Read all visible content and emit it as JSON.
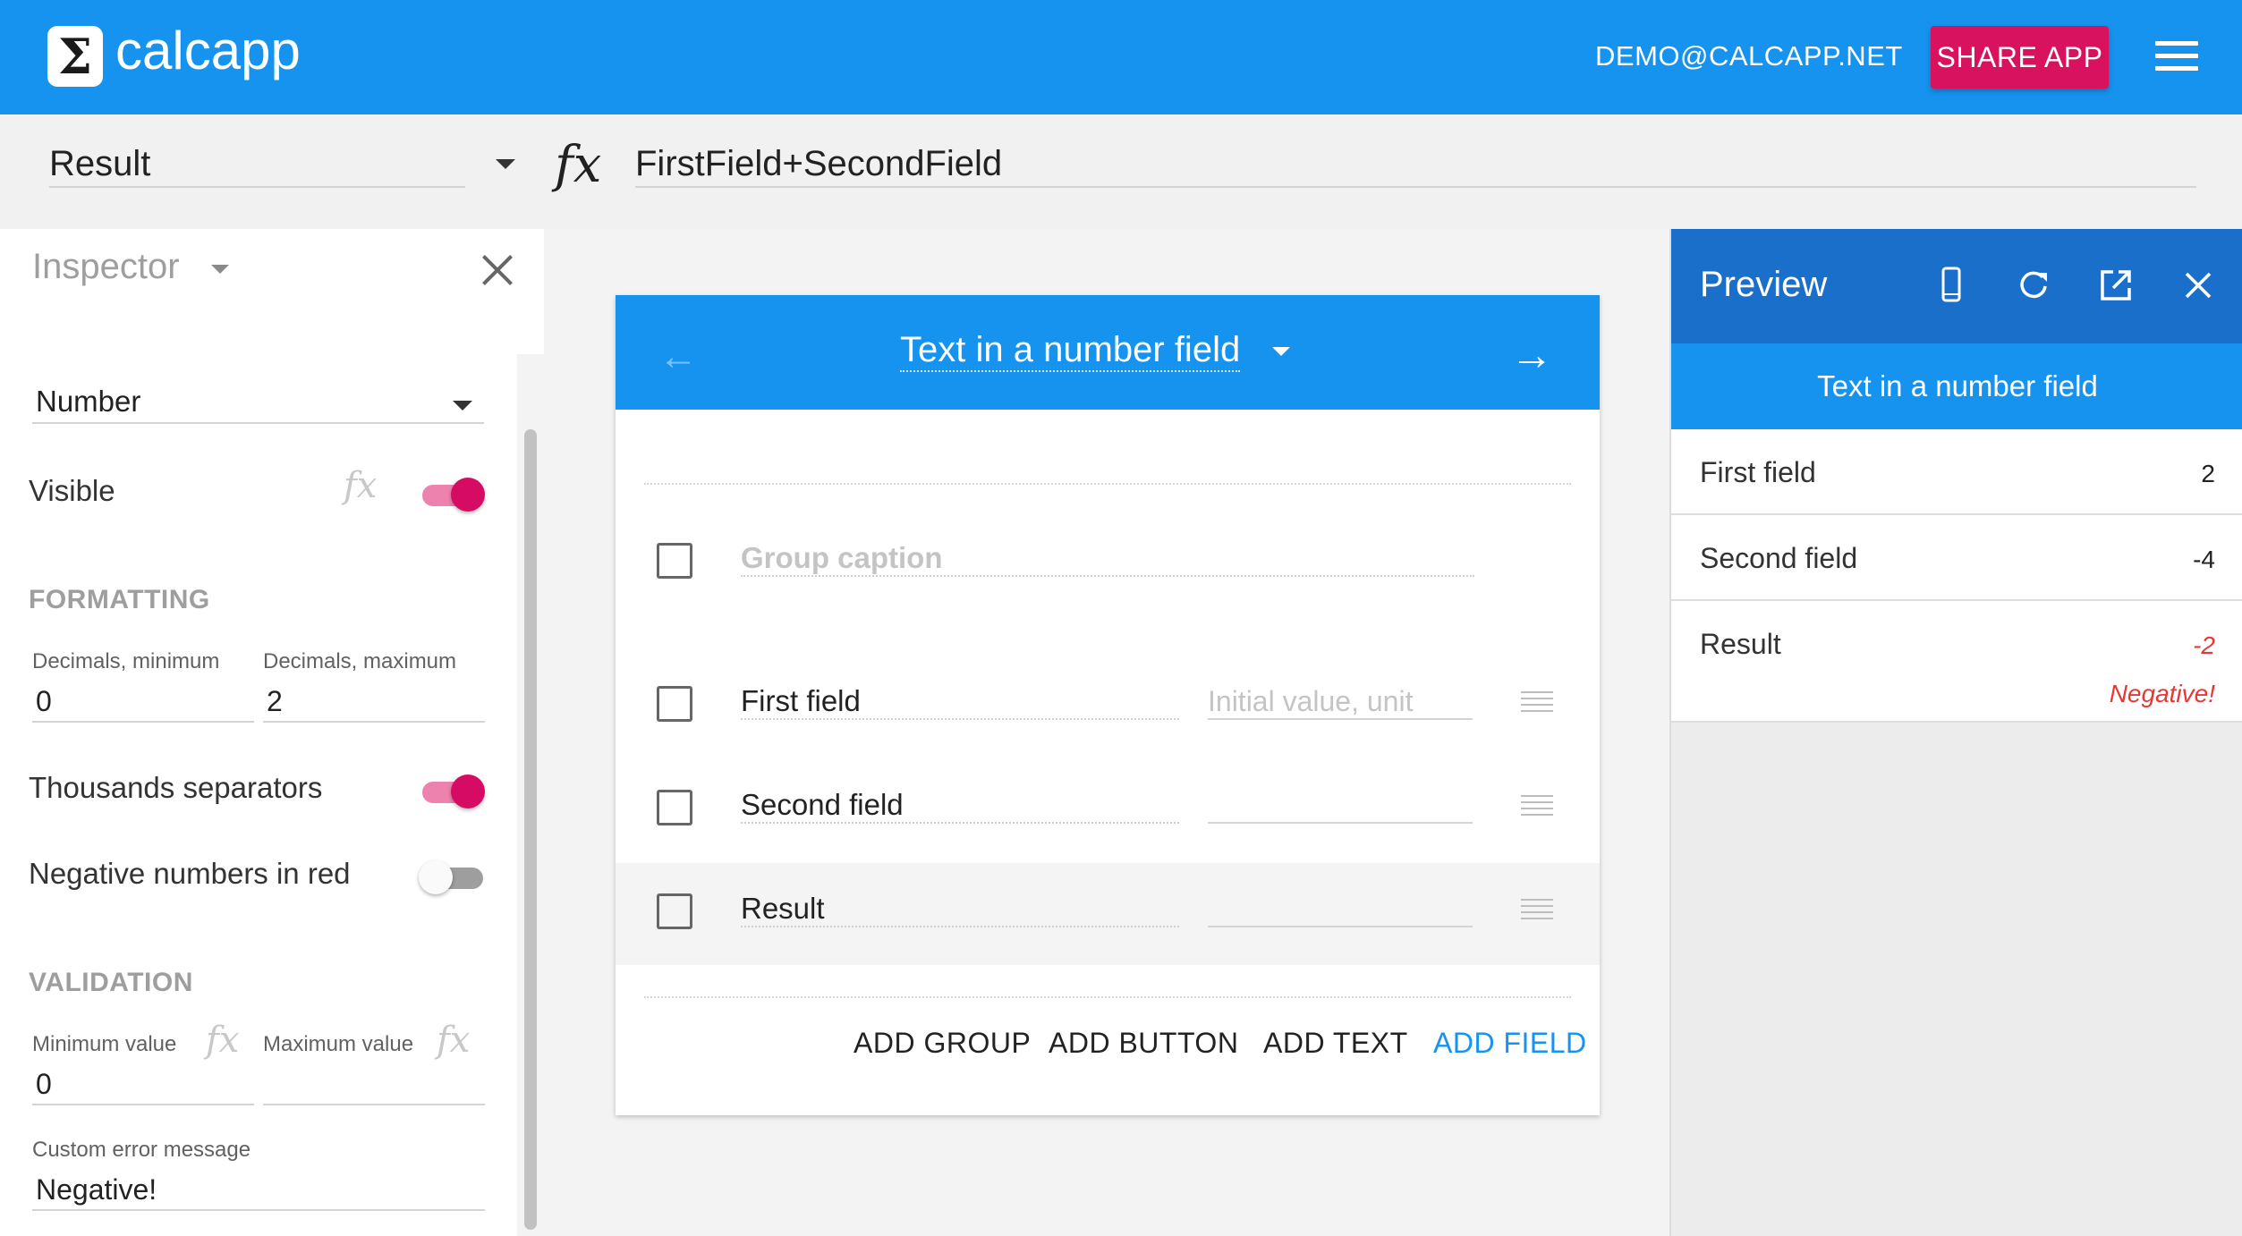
{
  "app": {
    "logo_symbol": "Σ",
    "name": "calcapp",
    "account": "DEMO@CALCAPP.NET",
    "share_label": "SHARE APP",
    "accent_color": "#1693ef",
    "share_color": "#d8125e"
  },
  "formula_bar": {
    "selected": "Result",
    "fx_symbol": "fx",
    "formula": "FirstField+SecondField"
  },
  "inspector": {
    "title": "Inspector",
    "type": "Number",
    "visible_label": "Visible",
    "visible_on": true,
    "fx_symbol": "fx",
    "formatting_heading": "FORMATTING",
    "dec_min_label": "Decimals, minimum",
    "dec_min_value": "0",
    "dec_max_label": "Decimals, maximum",
    "dec_max_value": "2",
    "thousands_label": "Thousands separators",
    "thousands_on": true,
    "negative_red_label": "Negative numbers in red",
    "negative_red_on": false,
    "validation_heading": "VALIDATION",
    "min_label": "Minimum value",
    "min_value": "0",
    "max_label": "Maximum value",
    "max_value": "",
    "error_label": "Custom error message",
    "error_value": "Negative!"
  },
  "screen": {
    "title": "Text in a number field",
    "group_caption_placeholder": "Group caption",
    "initial_value_placeholder": "Initial value, unit",
    "fields": [
      {
        "name": "First field",
        "selected": false
      },
      {
        "name": "Second field",
        "selected": false
      },
      {
        "name": "Result",
        "selected": true
      }
    ],
    "actions": [
      "ADD GROUP",
      "ADD BUTTON",
      "ADD TEXT",
      "ADD FIELD"
    ]
  },
  "preview": {
    "title": "Preview",
    "screen_title": "Text in a number field",
    "rows": [
      {
        "label": "First field",
        "value": "2"
      },
      {
        "label": "Second field",
        "value": "-4"
      },
      {
        "label": "Result",
        "value": "-2",
        "error": "Negative!"
      }
    ]
  }
}
